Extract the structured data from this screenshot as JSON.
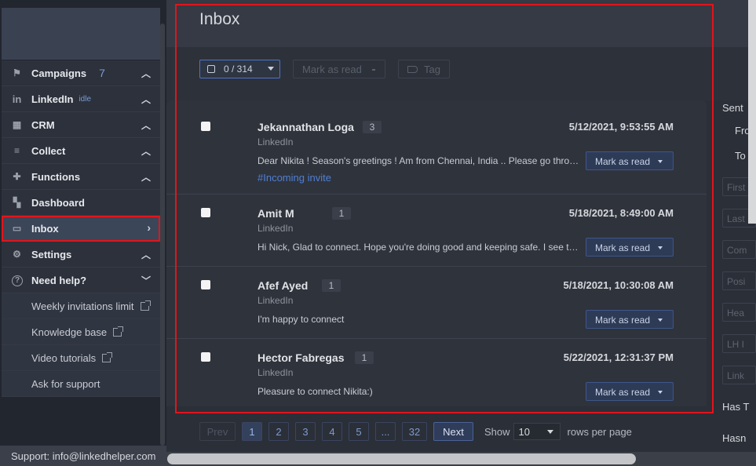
{
  "sidebar": {
    "items": [
      {
        "label": "Campaigns",
        "icon": "flag-icon",
        "count": "7",
        "chevron": "up"
      },
      {
        "label": "LinkedIn",
        "icon": "linkedin-icon",
        "status": "idle",
        "chevron": "up"
      },
      {
        "label": "CRM",
        "icon": "grid-icon",
        "chevron": "up"
      },
      {
        "label": "Collect",
        "icon": "list-add-icon",
        "chevron": "up"
      },
      {
        "label": "Functions",
        "icon": "puzzle-icon",
        "chevron": "up"
      },
      {
        "label": "Dashboard",
        "icon": "dashboard-icon"
      },
      {
        "label": "Inbox",
        "icon": "inbox-icon",
        "chevron": "right",
        "active": true
      },
      {
        "label": "Settings",
        "icon": "gear-icon",
        "chevron": "up"
      },
      {
        "label": "Need help?",
        "icon": "question-icon",
        "chevron": "down"
      }
    ],
    "help_links": [
      {
        "label": "Weekly invitations limit",
        "external": true
      },
      {
        "label": "Knowledge base",
        "external": true
      },
      {
        "label": "Video tutorials",
        "external": true
      },
      {
        "label": "Ask for support",
        "external": false
      }
    ],
    "support": "Support: info@linkedhelper.com"
  },
  "main": {
    "title": "Inbox",
    "toolbar": {
      "selection": "0 / 314",
      "mark_as_read": "Mark as read",
      "tag": "Tag"
    },
    "messages": [
      {
        "name": "Jekannathan Loga",
        "count": "3",
        "date": "5/12/2021, 9:53:55 AM",
        "source": "LinkedIn",
        "message": "Dear Nikita ! Season's greetings ! Am from Chennai, India .. Please go through my profile and let me know",
        "hashtag": "#Incoming invite",
        "button": "Mark as read"
      },
      {
        "name": "Amit M",
        "count": "1",
        "date": "5/18/2021, 8:49:00 AM",
        "source": "LinkedIn",
        "message": "Hi Nick, Glad to connect. Hope you're doing good and keeping safe. I see that you are working",
        "hashtag": "",
        "button": "Mark as read"
      },
      {
        "name": "Afef Ayed",
        "count": "1",
        "date": "5/18/2021, 10:30:08 AM",
        "source": "LinkedIn",
        "message": "I'm happy to connect",
        "hashtag": "",
        "button": "Mark as read"
      },
      {
        "name": "Hector Fabregas",
        "count": "1",
        "date": "5/22/2021, 12:31:37 PM",
        "source": "LinkedIn",
        "message": "Pleasure to connect Nikita:)",
        "hashtag": "",
        "button": "Mark as read"
      }
    ],
    "pagination": {
      "prev": "Prev",
      "pages": [
        "1",
        "2",
        "3",
        "4",
        "5",
        "...",
        "32"
      ],
      "current": "1",
      "next": "Next",
      "show_label": "Show",
      "rows_value": "10",
      "rows_label": "rows per page"
    }
  },
  "right_panel": {
    "sent_label": "Sent",
    "from_label": "Fro",
    "to_label": "To",
    "inputs": [
      "First",
      "Last",
      "Com",
      "Posi",
      "Hea",
      "LH I",
      "Link"
    ],
    "has_label": "Has T",
    "hasn_label": "Hasn"
  },
  "colors": {
    "accent": "#4d74c9",
    "highlight": "#e3141b",
    "hashtag": "#4f7fd4"
  }
}
